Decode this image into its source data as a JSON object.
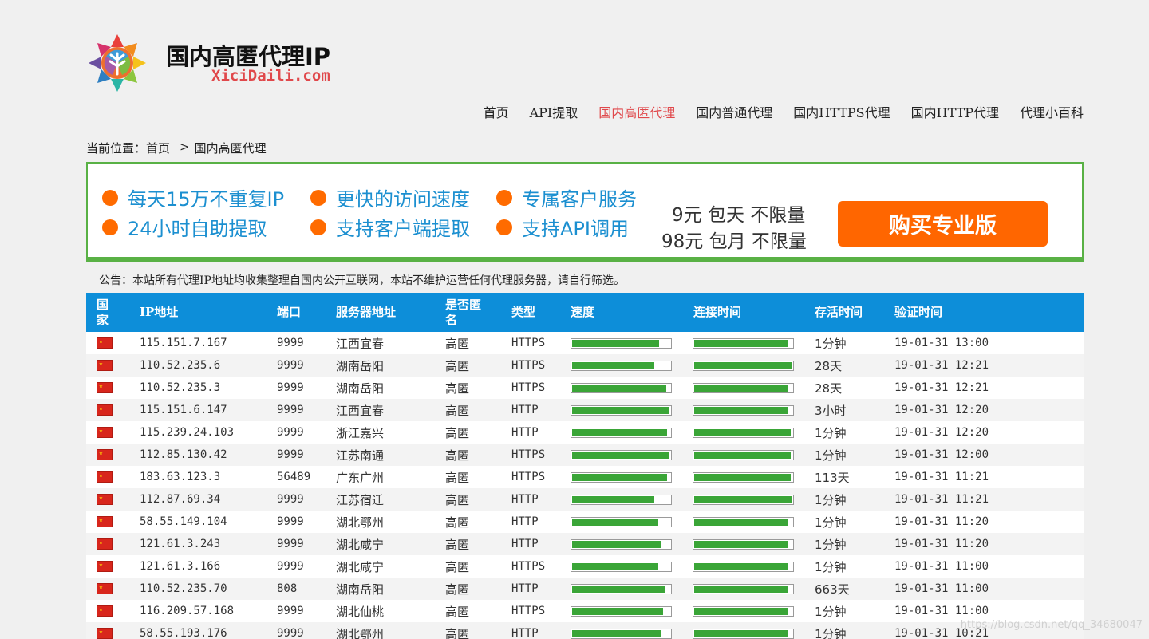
{
  "header": {
    "site_title": "国内高匿代理IP",
    "site_subtitle": "XiciDaili.com",
    "nav": [
      {
        "label": "首页",
        "active": false
      },
      {
        "label": "API提取",
        "active": false
      },
      {
        "label": "国内高匿代理",
        "active": true
      },
      {
        "label": "国内普通代理",
        "active": false
      },
      {
        "label": "国内HTTPS代理",
        "active": false
      },
      {
        "label": "国内HTTP代理",
        "active": false
      },
      {
        "label": "代理小百科",
        "active": false
      }
    ]
  },
  "breadcrumb": {
    "prefix": "当前位置：",
    "home": "首页",
    "separator": ">",
    "current": "国内高匿代理"
  },
  "banner": {
    "features": [
      "每天15万不重复IP",
      "更快的访问速度",
      "专属客户服务",
      "24小时自助提取",
      "支持客户端提取",
      "支持API调用"
    ],
    "price_day": "9元 包天 不限量",
    "price_month": "98元 包月 不限量",
    "buy_label": "购买专业版"
  },
  "notice": "公告：本站所有代理IP地址均收集整理自国内公开互联网，本站不维护运营任何代理服务器，请自行筛选。",
  "table": {
    "headers": {
      "country": "国家",
      "ip": "IP地址",
      "port": "端口",
      "location": "服务器地址",
      "anon": "是否匿名",
      "type": "类型",
      "speed": "速度",
      "connect": "连接时间",
      "alive": "存活时间",
      "verified": "验证时间"
    },
    "rows": [
      {
        "ip": "115.151.7.167",
        "port": "9999",
        "location": "江西宜春",
        "anon": "高匿",
        "type": "HTTPS",
        "speed": 0.89,
        "connect": 0.96,
        "alive": "1分钟",
        "verified": "19-01-31 13:00"
      },
      {
        "ip": "110.52.235.6",
        "port": "9999",
        "location": "湖南岳阳",
        "anon": "高匿",
        "type": "HTTPS",
        "speed": 0.84,
        "connect": 0.99,
        "alive": "28天",
        "verified": "19-01-31 12:21"
      },
      {
        "ip": "110.52.235.3",
        "port": "9999",
        "location": "湖南岳阳",
        "anon": "高匿",
        "type": "HTTPS",
        "speed": 0.96,
        "connect": 0.96,
        "alive": "28天",
        "verified": "19-01-31 12:21"
      },
      {
        "ip": "115.151.6.147",
        "port": "9999",
        "location": "江西宜春",
        "anon": "高匿",
        "type": "HTTP",
        "speed": 0.99,
        "connect": 0.95,
        "alive": "3小时",
        "verified": "19-01-31 12:20"
      },
      {
        "ip": "115.239.24.103",
        "port": "9999",
        "location": "浙江嘉兴",
        "anon": "高匿",
        "type": "HTTP",
        "speed": 0.97,
        "connect": 0.98,
        "alive": "1分钟",
        "verified": "19-01-31 12:20"
      },
      {
        "ip": "112.85.130.42",
        "port": "9999",
        "location": "江苏南通",
        "anon": "高匿",
        "type": "HTTPS",
        "speed": 0.99,
        "connect": 0.98,
        "alive": "1分钟",
        "verified": "19-01-31 12:00"
      },
      {
        "ip": "183.63.123.3",
        "port": "56489",
        "location": "广东广州",
        "anon": "高匿",
        "type": "HTTPS",
        "speed": 0.97,
        "connect": 0.98,
        "alive": "113天",
        "verified": "19-01-31 11:21"
      },
      {
        "ip": "112.87.69.34",
        "port": "9999",
        "location": "江苏宿迁",
        "anon": "高匿",
        "type": "HTTP",
        "speed": 0.84,
        "connect": 0.99,
        "alive": "1分钟",
        "verified": "19-01-31 11:21"
      },
      {
        "ip": "58.55.149.104",
        "port": "9999",
        "location": "湖北鄂州",
        "anon": "高匿",
        "type": "HTTP",
        "speed": 0.88,
        "connect": 0.95,
        "alive": "1分钟",
        "verified": "19-01-31 11:20"
      },
      {
        "ip": "121.61.3.243",
        "port": "9999",
        "location": "湖北咸宁",
        "anon": "高匿",
        "type": "HTTP",
        "speed": 0.91,
        "connect": 0.96,
        "alive": "1分钟",
        "verified": "19-01-31 11:20"
      },
      {
        "ip": "121.61.3.166",
        "port": "9999",
        "location": "湖北咸宁",
        "anon": "高匿",
        "type": "HTTPS",
        "speed": 0.88,
        "connect": 0.96,
        "alive": "1分钟",
        "verified": "19-01-31 11:00"
      },
      {
        "ip": "110.52.235.70",
        "port": "808",
        "location": "湖南岳阳",
        "anon": "高匿",
        "type": "HTTP",
        "speed": 0.95,
        "connect": 0.96,
        "alive": "663天",
        "verified": "19-01-31 11:00"
      },
      {
        "ip": "116.209.57.168",
        "port": "9999",
        "location": "湖北仙桃",
        "anon": "高匿",
        "type": "HTTPS",
        "speed": 0.93,
        "connect": 0.96,
        "alive": "1分钟",
        "verified": "19-01-31 11:00"
      },
      {
        "ip": "58.55.193.176",
        "port": "9999",
        "location": "湖北鄂州",
        "anon": "高匿",
        "type": "HTTP",
        "speed": 0.9,
        "connect": 0.95,
        "alive": "1分钟",
        "verified": "19-01-31 10:21"
      }
    ]
  },
  "watermark": "https://blog.csdn.net/qq_34680047",
  "colors": {
    "accent": "#0d8ed9",
    "nav_active": "#e0484b",
    "bar_fill": "#3aa537",
    "buy_button": "#ff6600",
    "banner_border": "#59b145",
    "feature_text": "#1b8fd0"
  }
}
